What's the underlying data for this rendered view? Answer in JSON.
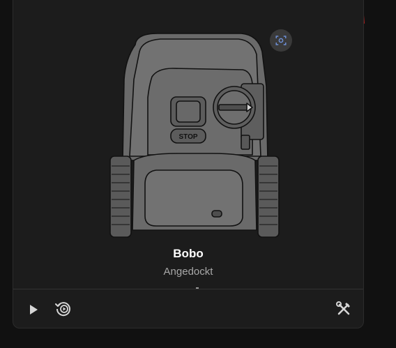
{
  "device": {
    "name": "Bobo",
    "status": "Angedockt"
  },
  "mower_image": {
    "button_label": "STOP"
  },
  "icons": {
    "camera": "camera-scan-icon",
    "play": "play-icon",
    "return_to_dock": "return-to-dock-icon",
    "tools": "tools-icon"
  },
  "colors": {
    "background": "#111111",
    "card": "#1c1c1c",
    "annotation": "#e02020",
    "camera_icon": "#6d8fd6",
    "icon": "#d6d6d6",
    "name_text": "#ffffff",
    "status_text": "#a8a8a8"
  }
}
